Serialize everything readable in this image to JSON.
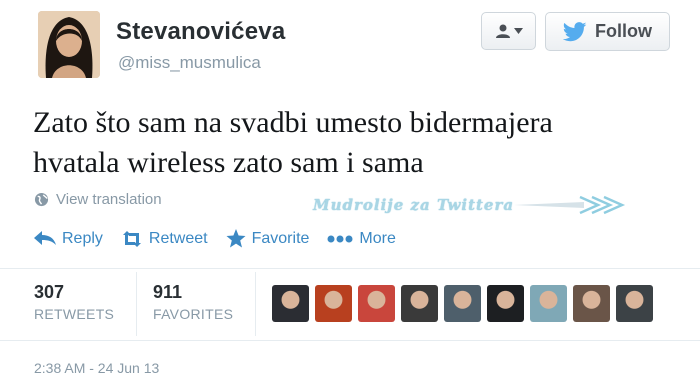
{
  "user": {
    "display_name": "Stevanovićeva",
    "screen_name": "@miss_musmulica"
  },
  "buttons": {
    "follow_label": "Follow"
  },
  "tweet": {
    "text_line1": "Zato što sam na svadbi umesto bidermajera",
    "text_line2": "hvatala wireless zato sam i sama"
  },
  "translate_label": "View translation",
  "watermark": "Mudrolije za Twittera",
  "actions": {
    "reply": "Reply",
    "retweet": "Retweet",
    "favorite": "Favorite",
    "more": "More"
  },
  "stats": {
    "retweets_count": "307",
    "retweets_label": "RETWEETS",
    "favorites_count": "911",
    "favorites_label": "FAVORITES"
  },
  "favoriters": [
    {
      "color": "#2b2d33"
    },
    {
      "color": "#b8401f"
    },
    {
      "color": "#c9463c"
    },
    {
      "color": "#3a3a3a"
    },
    {
      "color": "#4e5f6b"
    },
    {
      "color": "#1d1f22"
    },
    {
      "color": "#7fa8b6"
    },
    {
      "color": "#6a5548"
    },
    {
      "color": "#3c4246"
    }
  ],
  "timestamp": "2:38 AM - 24 Jun 13",
  "colors": {
    "link_blue": "#3b88c3",
    "muted_gray": "#8899a6",
    "twitter_bird": "#55acee"
  },
  "icons": {
    "user_dropdown": "user-dropdown-icon",
    "follow": "twitter-bird-icon",
    "translate": "globe-icon",
    "reply": "reply-arrow-icon",
    "retweet": "retweet-icon",
    "favorite": "star-icon",
    "more": "more-dots-icon"
  }
}
